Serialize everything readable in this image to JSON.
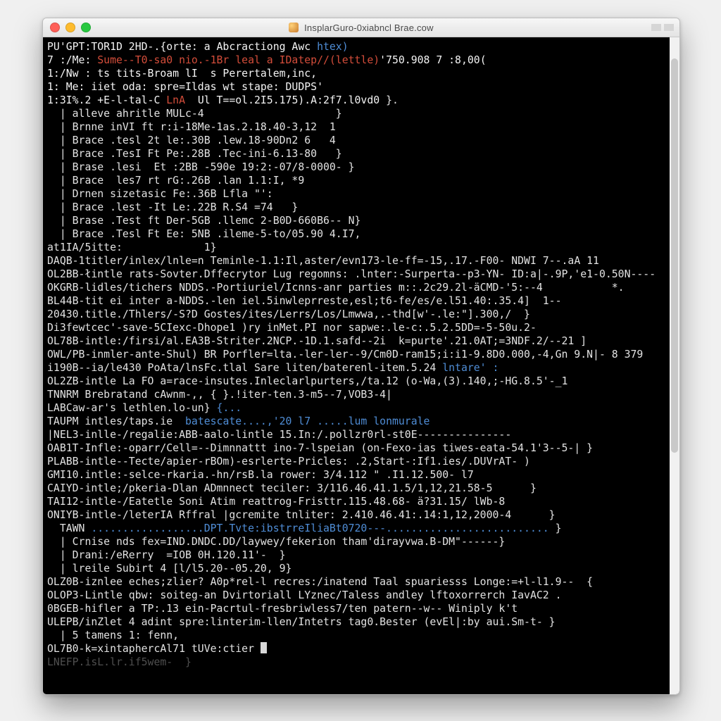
{
  "window": {
    "title": "InsplarGuro-0xiabncl Brae.cow"
  },
  "lines": [
    {
      "segs": [
        {
          "t": "PU'GPT:TOR1D 2HD-.{orte: a Abcractiong Awc ",
          "c": "c-white"
        },
        {
          "t": "htex)",
          "c": "c-blue"
        }
      ]
    },
    {
      "segs": [
        {
          "t": "7 :/Me:",
          "c": "c-white"
        },
        {
          "t": " Sume--T0-sa0 nio.-1Br leal a IDatep//(lettle)",
          "c": "c-red"
        },
        {
          "t": "'750.908 7 :8,00(",
          "c": "c-white"
        }
      ]
    },
    {
      "segs": [
        {
          "t": "1:/Nw : ts tits-Broam lI  s Perertalem,inc,",
          "c": "c-white"
        }
      ]
    },
    {
      "segs": [
        {
          "t": "1: Me: iiet oda: spre=Ildas wt stape: DUDPS'",
          "c": "c-white"
        }
      ]
    },
    {
      "segs": [
        {
          "t": "1:3I%.2 +E-l-tal-C ",
          "c": "c-white"
        },
        {
          "t": "LnA",
          "c": "c-red"
        },
        {
          "t": "  Ul T==ol.2I5.175).A:2f7.l0vd0",
          "c": "c-white"
        },
        {
          "t": " }.",
          "c": "c-wht2"
        }
      ]
    },
    {
      "segs": [
        {
          "t": "  | alleve ahritle MULc-4                     }",
          "c": "c-wht2"
        }
      ]
    },
    {
      "segs": [
        {
          "t": "  | Brnne inVI ft r:i-18Me-1as.2.18.40-3,12  1",
          "c": "c-wht2"
        }
      ]
    },
    {
      "segs": [
        {
          "t": "  | Brace .tesl 2t le:.30B .lew.18-90Dn2 6   4",
          "c": "c-wht2"
        }
      ]
    },
    {
      "segs": [
        {
          "t": "  | Brace .TesI Ft Pe:.28B .Tec-ini-6.13-80   }",
          "c": "c-wht2"
        }
      ]
    },
    {
      "segs": [
        {
          "t": "  | Brase .lesi  Et :2BB -590e 19:2:-07/8-0000- }",
          "c": "c-wht2"
        }
      ]
    },
    {
      "segs": [
        {
          "t": "  | Brace  les7 rt rG:.26B .lan 1.1:I, *9",
          "c": "c-wht2"
        }
      ]
    },
    {
      "segs": [
        {
          "t": "  | Drnen sizetasic Fe:.36B Lfla \"':",
          "c": "c-wht2"
        }
      ]
    },
    {
      "segs": [
        {
          "t": "  | Brace .lest -It Le:.22B R.S4 =74   }",
          "c": "c-wht2"
        }
      ]
    },
    {
      "segs": [
        {
          "t": "  | Brase .Test ft Der-5GB .llemc 2-B0D-660B6-- N}",
          "c": "c-wht2"
        }
      ]
    },
    {
      "segs": [
        {
          "t": "  | Brace .Tesl Ft Ee: 5NB .ileme-5-to/05.90 4.I7,",
          "c": "c-wht2"
        }
      ]
    },
    {
      "segs": [
        {
          "t": "at1IA/5itte:             1}",
          "c": "c-wht2"
        }
      ]
    },
    {
      "segs": [
        {
          "t": "DAQB-1titler/inlex/lnle=n Teminle-1.1:Il,aster/evn173-le-ff=-15,.17.-F00- ",
          " c": "c-wht2"
        },
        {
          "t": "NDWI 7--.aA 11",
          "c": "c-wht2"
        }
      ]
    },
    {
      "segs": [
        {
          "t": "OL2BB-łintle rats-Sovter.Dffecrytor Lug regomns: .lnter:-Surperta--p3-YN- ID:a|-.9P,'e1-0.50N----",
          "c": "c-wht2"
        }
      ]
    },
    {
      "segs": [
        {
          "t": "OKGRB-lidles/tichers NDDS.-Portiuriel/Icnns-anr parties m::.2c29.2l-äCMD-'5:--4           *.",
          "c": "c-wht2"
        }
      ]
    },
    {
      "segs": [
        {
          "t": "BL44B-tit ei inter a-NDDS.-len iel.5inwleprreste,esl;t6-fe/es/e.l51.40:.35.4]  1--",
          "c": "c-wht2"
        }
      ]
    },
    {
      "segs": [
        {
          "t": "20430.title./Thlers/-S?D Gostes/ites/Lerrs/Los/Lmwwa,.-thd[w'-.le:\"].300,/  }",
          "c": "c-wht2"
        }
      ]
    },
    {
      "segs": [
        {
          "t": "Di3fewtcec'-save-5CIexc-Dhope1 )ry inMet.PI nor sapwe:.le-c:.5.2.5DD=-5-50u.2-",
          "c": "c-wht2"
        }
      ]
    },
    {
      "segs": [
        {
          "t": "OL78B-intle:/firsi/al.EA3B-Striter.2NCP.-1D.1.safd--2i  k=purte'.21.0AT;=3NDF.2/--21 ]",
          "c": "c-wht2"
        }
      ]
    },
    {
      "segs": [
        {
          "t": "OWL/PB-inmler-ante-Shul) BR Porfler=lta.-ler-ler--9/Cm0D-ram15;i:i1-9.8D0.000,-4,Gn 9.N|- 8 379",
          "c": "c-wht2"
        }
      ]
    },
    {
      "segs": [
        {
          "t": "i190B--ia/le430 PoAta/lnsFc.tlal Sare liten/baterenl-item.5.24 ",
          "c": "c-wht2"
        },
        {
          "t": "lntare' :",
          "c": "c-blue"
        }
      ]
    },
    {
      "segs": [
        {
          "t": "OL2ZB-intle La FO a=race-insutes.Inleclarlpurters,/ta.12 (o-Wa,(3).140,;-HG.8.5'-_1",
          "c": "c-wht2"
        }
      ]
    },
    {
      "segs": [
        {
          "t": "TNNRM Brebratand cAwnm-,, { }.!iter-ten.3-m5--7,VOB3-4|",
          "c": "c-wht2"
        }
      ]
    },
    {
      "segs": [
        {
          "t": "LABCaw-ar's lethlen.lo-un}",
          "c": "c-wht2"
        },
        {
          "t": " {...",
          "c": "c-blue"
        }
      ]
    },
    {
      "segs": [
        {
          "t": "TAUPM intles/taps.ie  ",
          "c": "c-wht2"
        },
        {
          "t": "batescate....,'20 l7 .....lum lonmurale",
          "c": "c-blue"
        }
      ]
    },
    {
      "segs": [
        {
          "t": "|NEL3-inlle-/regalie:ABB-aalo-lintle 15.In:/.pollzr0rl-st0E---------------",
          "c": "c-wht2"
        }
      ]
    },
    {
      "segs": [
        {
          "t": "OAB1T-Infle:-oparr/Cell=--Dimnnattt ino-7-lspeian (on-Fexo-ias tiwes-eata-54.1'3--5-| }",
          "c": "c-wht2"
        }
      ]
    },
    {
      "segs": [
        {
          "t": "PLABB-intle--Tecte/apier-rBOm)-esrlerte-Pricles: .2,Start-:If1.ies/.DUVrAT- )",
          "c": "c-wht2"
        }
      ]
    },
    {
      "segs": [
        {
          "t": "GMI10.intle:-selce-rkaria.-hn/rsB.la rower: 3/4.112 ",
          " c": "c-wht2"
        },
        {
          "t": "\"",
          "c": "c-wht2"
        },
        {
          "t": " .I1.12.500- l7",
          "c": "c-wht2"
        }
      ]
    },
    {
      "segs": [
        {
          "t": "CAIYD-intle;/pkeria-Dlan ADmnnect teciler: 3/116.46.41.1.5/1,12,21.58-5      }",
          "c": "c-wht2"
        }
      ]
    },
    {
      "segs": [
        {
          "t": "TAI12-intle-/Eatetle Soni Atim reattrog-Fristtr.115.48.68- ä?31.15/ lWb-8",
          "c": "c-wht2"
        }
      ]
    },
    {
      "segs": [
        {
          "t": "ONIYB-intle-/leterIA Rffral |gcremite tnliter: 2.410.46.41:.14:1,12,2000-4      }",
          "c": "c-wht2"
        }
      ]
    },
    {
      "segs": [
        {
          "t": "  TAWN ",
          "c": "c-wht2"
        },
        {
          "t": "..................DPT.Tvte:ibstrreIliaBt0720---..........................",
          "c": "c-blue"
        },
        {
          "t": " }",
          "c": "c-wht2"
        }
      ]
    },
    {
      "segs": [
        {
          "t": "  | Crnise nds fex=IND.DNDC.DD/laywey/fekerion tham'dirayvwa.B-DM\"------}",
          "c": "c-wht2"
        }
      ]
    },
    {
      "segs": [
        {
          "t": "  | Drani:/eRerry  =IOB 0H.120.11'-  }",
          "c": "c-wht2"
        }
      ]
    },
    {
      "segs": [
        {
          "t": "  | lreile Subirt 4 [l/l5.20--05.20, 9}",
          "c": "c-wht2"
        }
      ]
    },
    {
      "segs": [
        {
          "t": "OLZ0B-iznlee eches;zlier? A0p*rel-l recres:/inatend Taal spuariesss Longe:=+l-l1.9--  {",
          "c": "c-wht2"
        }
      ]
    },
    {
      "segs": [
        {
          "t": "OLOP3-Lintle qbw: soiteg-an Dvirtoriall LYznec/Taless andley lftoxorrerch IavAC2 . ",
          "c": "c-wht2"
        }
      ]
    },
    {
      "segs": [
        {
          "t": "0BGEB-hifler a TP:.13 ein-Pacrtul-fresbriwless7/ten patern--w-- Winiply k't",
          "c": "c-wht2"
        }
      ]
    },
    {
      "segs": [
        {
          "t": "ULEPB/inZlet 4 adint spre:linterim-llen/Intetrs tag0.Bester (evEl|:by aui.Sm-t- }",
          "c": "c-wht2"
        }
      ]
    },
    {
      "segs": [
        {
          "t": "  | 5 tamens 1: fenn,",
          "c": "c-wht2"
        }
      ]
    },
    {
      "segs": [
        {
          "t": "OL7B0-k=xintaphercAl71 tUVe:ctier ",
          "c": "c-wht2"
        },
        {
          "t": "[CURSOR]",
          "c": "cursor"
        }
      ]
    },
    {
      "segs": [
        {
          "t": "LNEFP.isL.lr.if5wem-  }",
          "c": "c-dgray"
        }
      ]
    }
  ]
}
